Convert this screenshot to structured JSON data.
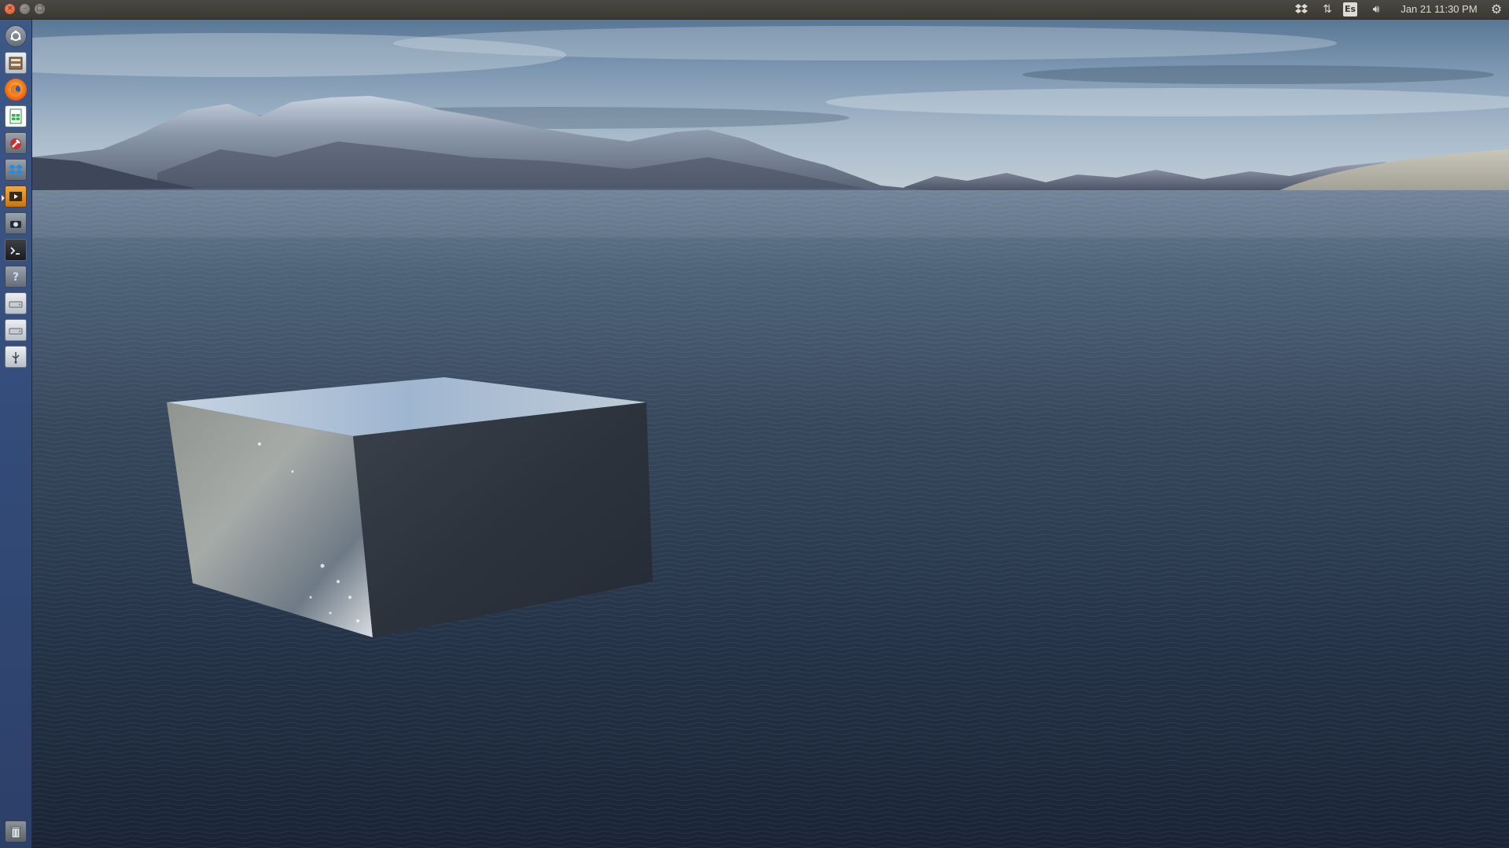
{
  "top_panel": {
    "window_buttons": [
      "close",
      "minimize",
      "maximize"
    ],
    "tray": {
      "dropbox_icon": "dropbox-icon",
      "network_icon": "network-arrows-icon",
      "keyboard_layout": "Es",
      "volume_icon": "volume-icon",
      "clock": "Jan 21 11:30 PM",
      "settings_icon": "gear-icon"
    }
  },
  "launcher": {
    "items": [
      {
        "name": "dash-home",
        "icon": "ubuntu-logo-icon"
      },
      {
        "name": "files",
        "icon": "file-cabinet-icon"
      },
      {
        "name": "firefox",
        "icon": "firefox-icon"
      },
      {
        "name": "libreoffice-calc",
        "icon": "spreadsheet-icon"
      },
      {
        "name": "system-settings",
        "icon": "wrench-icon"
      },
      {
        "name": "dropbox",
        "icon": "dropbox-icon"
      },
      {
        "name": "impress",
        "icon": "presentation-icon"
      },
      {
        "name": "webcam",
        "icon": "camera-icon"
      },
      {
        "name": "terminal",
        "icon": "terminal-icon"
      },
      {
        "name": "help",
        "icon": "question-icon"
      },
      {
        "name": "drive-1",
        "icon": "drive-icon"
      },
      {
        "name": "drive-2",
        "icon": "drive-icon"
      },
      {
        "name": "usb-drive",
        "icon": "usb-icon"
      },
      {
        "name": "trash",
        "icon": "trash-icon"
      }
    ]
  },
  "colors": {
    "panel": "#3c3b37",
    "launcher": "#354e7d",
    "sky_top": "#5b7899",
    "sea_dark": "#1b2638",
    "close_orange": "#df4b16"
  }
}
